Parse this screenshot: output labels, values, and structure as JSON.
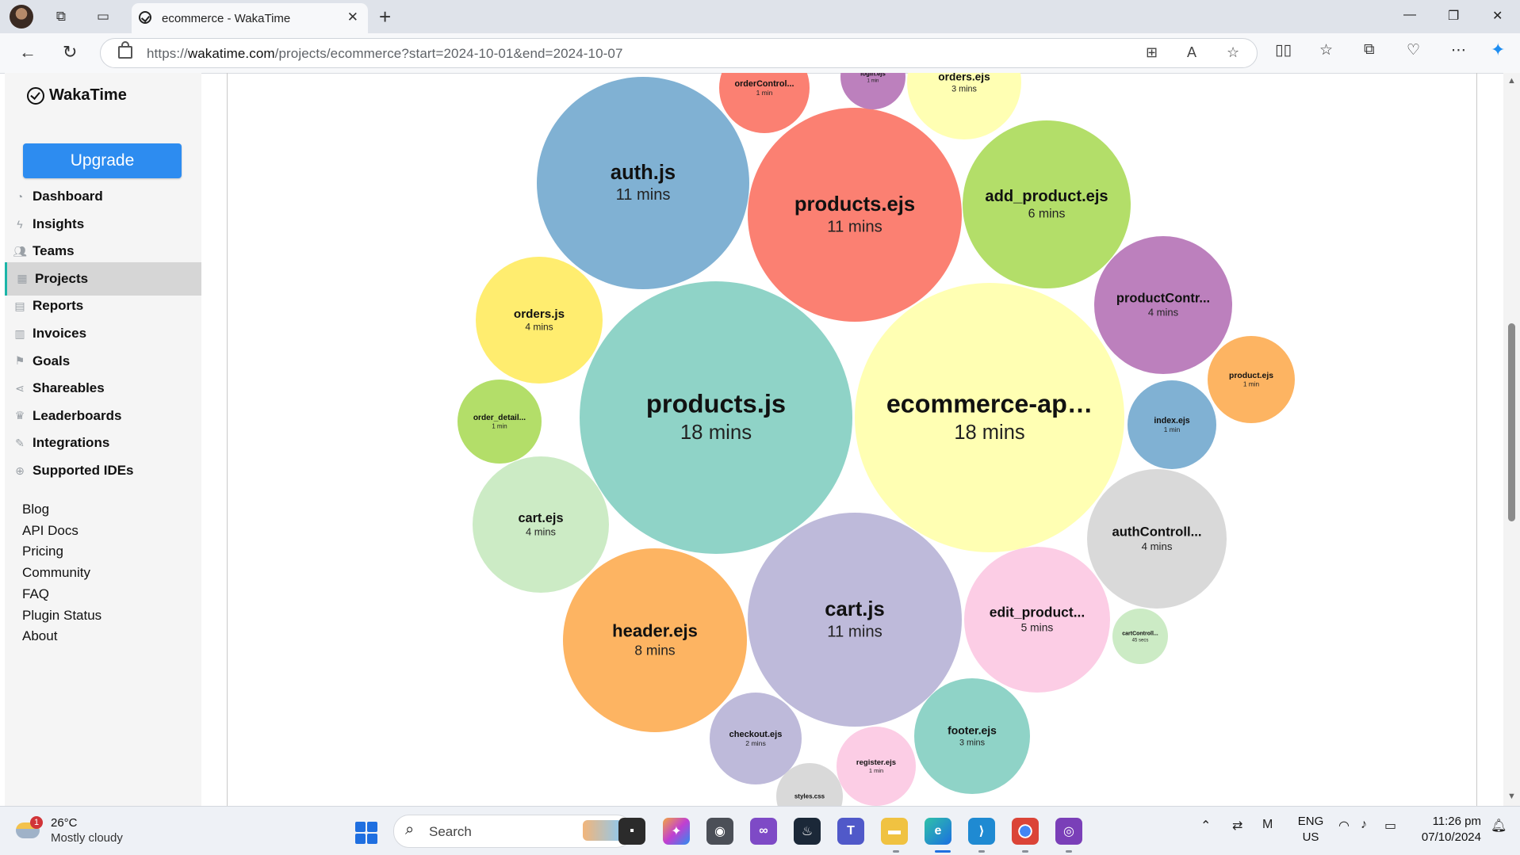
{
  "browser": {
    "tab_title": "ecommerce - WakaTime",
    "url_prefix": "https://",
    "url_domain": "wakatime.com",
    "url_path": "/projects/ecommerce?start=2024-10-01&end=2024-10-07"
  },
  "sidebar": {
    "brand": "WakaTime",
    "upgrade_label": "Upgrade",
    "items": [
      {
        "label": "Dashboard",
        "icon": "dashboard-icon"
      },
      {
        "label": "Insights",
        "icon": "bolt-icon"
      },
      {
        "label": "Teams",
        "icon": "users-icon"
      },
      {
        "label": "Projects",
        "icon": "grid-icon",
        "active": true
      },
      {
        "label": "Reports",
        "icon": "pdf-icon"
      },
      {
        "label": "Invoices",
        "icon": "file-icon"
      },
      {
        "label": "Goals",
        "icon": "flag-icon"
      },
      {
        "label": "Shareables",
        "icon": "share-icon"
      },
      {
        "label": "Leaderboards",
        "icon": "trophy-icon"
      },
      {
        "label": "Integrations",
        "icon": "wrench-icon"
      },
      {
        "label": "Supported IDEs",
        "icon": "plus-circle-icon"
      }
    ],
    "footer_links": [
      "Blog",
      "API Docs",
      "Pricing",
      "Community",
      "FAQ",
      "Plugin Status",
      "About"
    ]
  },
  "chart_data": {
    "type": "bubble",
    "unit": "mins",
    "bubbles": [
      {
        "name": "products.js",
        "display": "products.js",
        "time": "18 mins",
        "color": "#8fd3c7"
      },
      {
        "name": "ecommerce-ap…",
        "display": "ecommerce-ap…",
        "time": "18 mins",
        "color": "#ffffb3"
      },
      {
        "name": "auth.js",
        "display": "auth.js",
        "time": "11 mins",
        "color": "#80b1d3"
      },
      {
        "name": "products.ejs",
        "display": "products.ejs",
        "time": "11 mins",
        "color": "#fb8072"
      },
      {
        "name": "cart.js",
        "display": "cart.js",
        "time": "11 mins",
        "color": "#bebada"
      },
      {
        "name": "header.ejs",
        "display": "header.ejs",
        "time": "8 mins",
        "color": "#fdb462"
      },
      {
        "name": "add_product.ejs",
        "display": "add_product.ejs",
        "time": "6 mins",
        "color": "#b3de69"
      },
      {
        "name": "edit_product…",
        "display": "edit_product...",
        "time": "5 mins",
        "color": "#fccde5"
      },
      {
        "name": "productContr…",
        "display": "productContr...",
        "time": "4 mins",
        "color": "#bc80bd"
      },
      {
        "name": "authControll…",
        "display": "authControll...",
        "time": "4 mins",
        "color": "#d9d9d9"
      },
      {
        "name": "orders.js",
        "display": "orders.js",
        "time": "4 mins",
        "color": "#ffed6f"
      },
      {
        "name": "cart.ejs",
        "display": "cart.ejs",
        "time": "4 mins",
        "color": "#ccebc5"
      },
      {
        "name": "orders.ejs",
        "display": "orders.ejs",
        "time": "3 mins",
        "color": "#ffffb3"
      },
      {
        "name": "footer.ejs",
        "display": "footer.ejs",
        "time": "3 mins",
        "color": "#8fd3c7"
      },
      {
        "name": "checkout.ejs",
        "display": "checkout.ejs",
        "time": "2 mins",
        "color": "#bebada"
      },
      {
        "name": "orderControl…",
        "display": "orderControl...",
        "time": "1 min",
        "color": "#fb8072"
      },
      {
        "name": "login.ejs",
        "display": "login.ejs",
        "time": "1 min",
        "color": "#bc80bd"
      },
      {
        "name": "product.ejs",
        "display": "product.ejs",
        "time": "1 min",
        "color": "#fdb462"
      },
      {
        "name": "index.ejs",
        "display": "index.ejs",
        "time": "1 min",
        "color": "#80b1d3"
      },
      {
        "name": "order_detail…",
        "display": "order_detail...",
        "time": "1 min",
        "color": "#b3de69"
      },
      {
        "name": "register.ejs",
        "display": "register.ejs",
        "time": "1 min",
        "color": "#fccde5"
      },
      {
        "name": "cartControll…",
        "display": "cartControll...",
        "time": "45 secs",
        "color": "#ccebc5"
      },
      {
        "name": "styles.css",
        "display": "styles.css",
        "time": "",
        "color": "#d9d9d9"
      }
    ]
  },
  "taskbar": {
    "weather_temp": "26°C",
    "weather_desc": "Mostly cloudy",
    "weather_badge": "1",
    "search_label": "Search",
    "lang_top": "ENG",
    "lang_bottom": "US",
    "time": "11:26 pm",
    "date": "07/10/2024"
  }
}
